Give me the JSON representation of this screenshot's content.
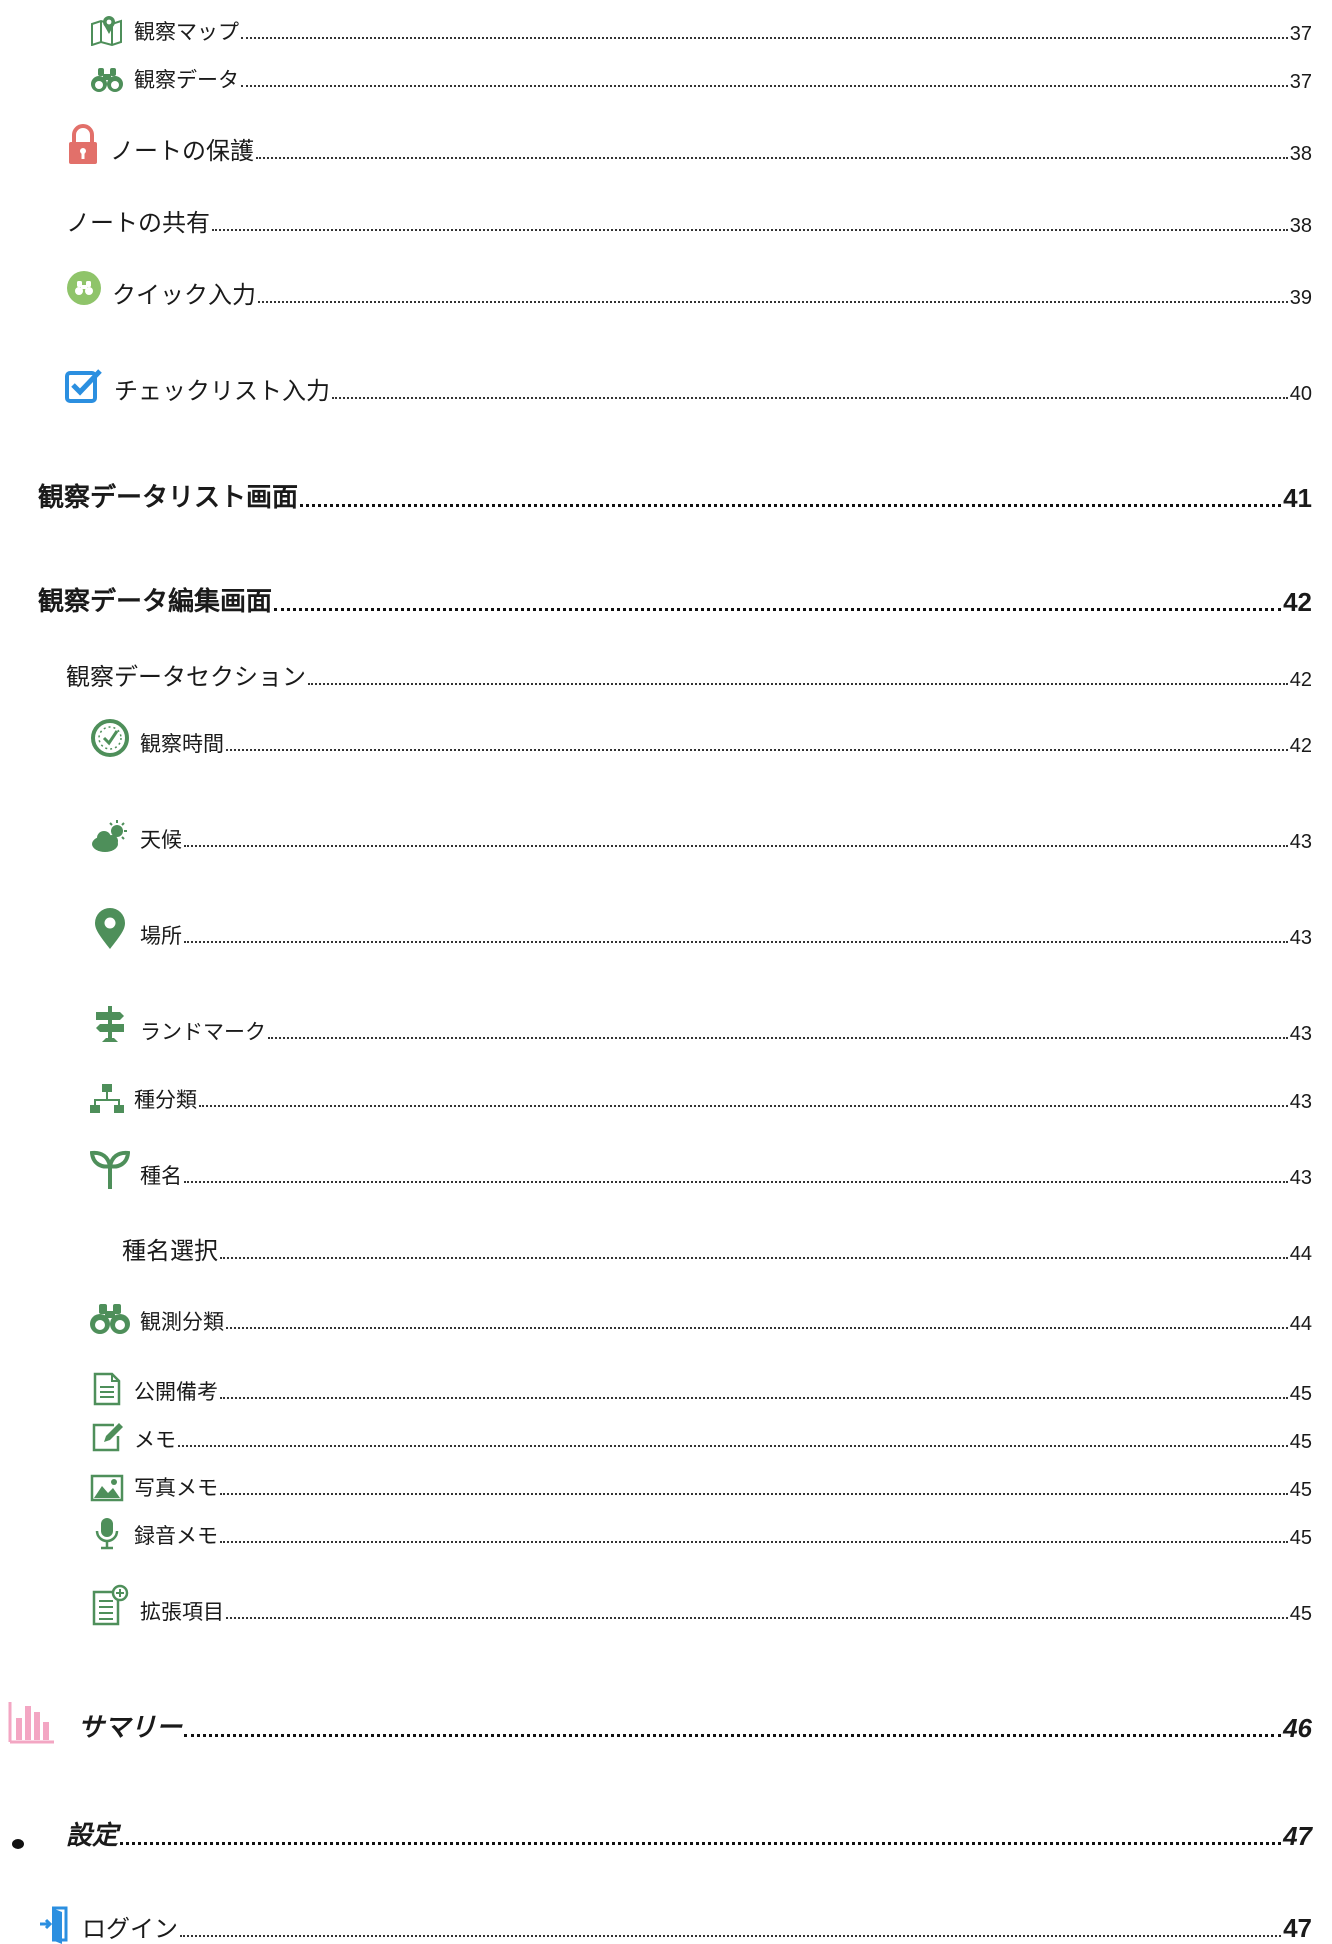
{
  "toc": {
    "map": {
      "label": "観察マップ",
      "page": "37",
      "icon": "map-icon"
    },
    "obs_data": {
      "label": "観察データ",
      "page": "37",
      "icon": "binoculars-icon"
    },
    "protect": {
      "label": "ノートの保護",
      "page": "38",
      "icon": "lock-icon"
    },
    "share": {
      "label": "ノートの共有",
      "page": "38"
    },
    "quick": {
      "label": "クイック入力",
      "page": "39",
      "icon": "quick-input-icon"
    },
    "checklist": {
      "label": "チェックリスト入力",
      "page": "40",
      "icon": "checkbox-icon"
    },
    "datalist": {
      "label": "観察データリスト画面",
      "page": "41"
    },
    "edit": {
      "label": "観察データ編集画面",
      "page": "42"
    },
    "section": {
      "label": "観察データセクション",
      "page": "42"
    },
    "time": {
      "label": "観察時間",
      "page": "42",
      "icon": "clock-icon"
    },
    "weather": {
      "label": "天候",
      "page": "43",
      "icon": "weather-icon"
    },
    "place": {
      "label": "場所",
      "page": "43",
      "icon": "location-pin-icon"
    },
    "landmark": {
      "label": "ランドマーク",
      "page": "43",
      "icon": "signpost-icon"
    },
    "taxonomy": {
      "label": "種分類",
      "page": "43",
      "icon": "hierarchy-icon"
    },
    "species": {
      "label": "種名",
      "page": "43",
      "icon": "sprout-icon"
    },
    "species_select": {
      "label": "種名選択",
      "page": "44"
    },
    "observation_class": {
      "label": "観測分類",
      "page": "44",
      "icon": "binoculars-icon"
    },
    "public_note": {
      "label": "公開備考",
      "page": "45",
      "icon": "document-icon"
    },
    "memo": {
      "label": "メモ",
      "page": "45",
      "icon": "edit-note-icon"
    },
    "photo_memo": {
      "label": "写真メモ",
      "page": "45",
      "icon": "image-icon"
    },
    "audio_memo": {
      "label": "録音メモ",
      "page": "45",
      "icon": "microphone-icon"
    },
    "extended": {
      "label": "拡張項目",
      "page": "45",
      "icon": "add-document-icon"
    },
    "summary": {
      "label": "サマリー",
      "page": "46",
      "icon": "bar-chart-icon"
    },
    "settings": {
      "label": "設定",
      "page": "47",
      "icon": "bullet"
    },
    "login": {
      "label": "ログイン",
      "page": "47",
      "icon": "login-icon"
    }
  },
  "colors": {
    "green": "#4e8f5a",
    "red": "#e2706a",
    "blue": "#2b8fe0",
    "pink": "#f3a6c3",
    "lightgreen": "#8fc46a"
  }
}
